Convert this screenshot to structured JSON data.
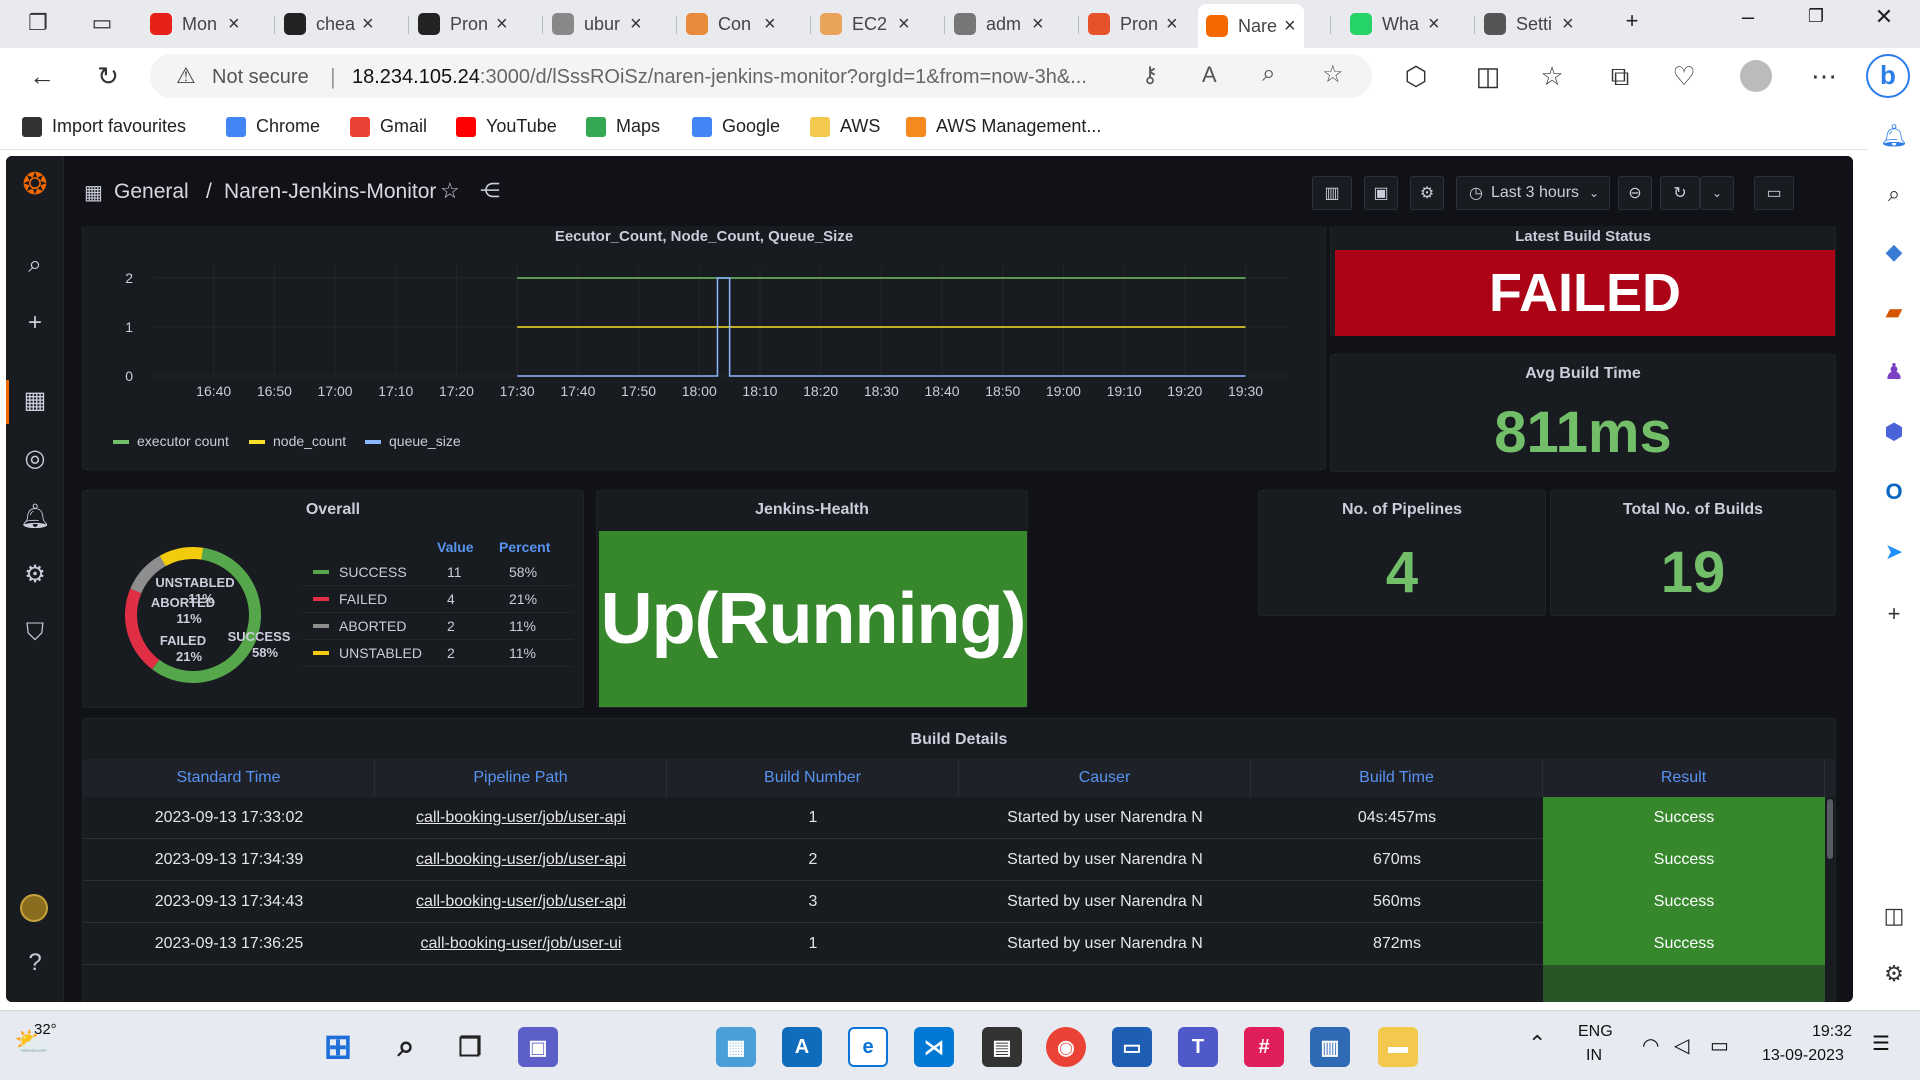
{
  "browser": {
    "tabs": [
      {
        "label": "Mon",
        "icon": "youtube-icon",
        "color": "#e62117"
      },
      {
        "label": "chea",
        "icon": "github-icon",
        "color": "#222222"
      },
      {
        "label": "Pron",
        "icon": "github-icon",
        "color": "#222222"
      },
      {
        "label": "ubur",
        "icon": "ubuntu-icon",
        "color": "#888888"
      },
      {
        "label": "Con",
        "icon": "console-icon",
        "color": "#e98a3a"
      },
      {
        "label": "EC2",
        "icon": "aws-cube-icon",
        "color": "#e9a35b"
      },
      {
        "label": "adm",
        "icon": "avatar-icon",
        "color": "#777777"
      },
      {
        "label": "Pron",
        "icon": "prometheus-icon",
        "color": "#e6522c"
      },
      {
        "label": "Nare",
        "icon": "grafana-icon",
        "color": "#f46800"
      },
      {
        "label": "Wha",
        "icon": "whatsapp-icon",
        "color": "#25d366"
      },
      {
        "label": "Setti",
        "icon": "gear-icon",
        "color": "#555555"
      }
    ],
    "security_label": "Not secure",
    "url_host": "18.234.105.24",
    "url_rest": ":3000/d/lSssROiSz/naren-jenkins-monitor?orgId=1&from=now-3h&...",
    "favourites": [
      {
        "label": "Import favourites",
        "icon": "import-icon",
        "color": "#333333"
      },
      {
        "label": "Chrome",
        "icon": "google-icon",
        "color": "#4285f4"
      },
      {
        "label": "Gmail",
        "icon": "gmail-icon",
        "color": "#ea4335"
      },
      {
        "label": "YouTube",
        "icon": "youtube-icon",
        "color": "#ff0000"
      },
      {
        "label": "Maps",
        "icon": "maps-icon",
        "color": "#34a853"
      },
      {
        "label": "Google",
        "icon": "google-icon",
        "color": "#4285f4"
      },
      {
        "label": "AWS",
        "icon": "folder-icon",
        "color": "#f2c94c"
      },
      {
        "label": "AWS Management...",
        "icon": "aws-cube-icon",
        "color": "#f48a1e"
      }
    ]
  },
  "grafana": {
    "breadcrumb_root": "General",
    "breadcrumb_sep": "/",
    "dashboard_title": "Naren-Jenkins-Monitor",
    "time_range": "Last 3 hours",
    "timeseries": {
      "title": "Eecutor_Count, Node_Count, Queue_Size"
    },
    "latest_build": {
      "title": "Latest Build Status",
      "value": "FAILED",
      "color": "#ad0317"
    },
    "avg_build": {
      "title": "Avg Build Time",
      "value": "811ms"
    },
    "overall": {
      "title": "Overall",
      "col_value": "Value",
      "col_percent": "Percent",
      "rows": [
        {
          "label": "SUCCESS",
          "value": "11",
          "percent": "58%",
          "color": "#56a64b"
        },
        {
          "label": "FAILED",
          "value": "4",
          "percent": "21%",
          "color": "#e02f44"
        },
        {
          "label": "ABORTED",
          "value": "2",
          "percent": "11%",
          "color": "#8e8e8e"
        },
        {
          "label": "UNSTABLED",
          "value": "2",
          "percent": "11%",
          "color": "#f2cc0c"
        }
      ],
      "slice_labels": [
        {
          "name": "UNSTABLED",
          "pct": "11%"
        },
        {
          "name": "ABORTED",
          "pct": "11%"
        },
        {
          "name": "FAILED",
          "pct": "21%"
        },
        {
          "name": "SUCCESS",
          "pct": "58%"
        }
      ]
    },
    "health": {
      "title": "Jenkins-Health",
      "value": "Up(Running)",
      "color": "#37872d"
    },
    "pipelines": {
      "title": "No. of Pipelines",
      "value": "4"
    },
    "total_builds": {
      "title": "Total No. of Builds",
      "value": "19"
    },
    "build_details": {
      "title": "Build Details",
      "columns": [
        "Standard Time",
        "Pipeline Path",
        "Build Number",
        "Causer",
        "Build Time",
        "Result"
      ],
      "rows": [
        {
          "time": "2023-09-13 17:33:02",
          "path": "call-booking-user/job/user-api",
          "num": "1",
          "causer": "Started by user Narendra N",
          "build_time": "04s:457ms",
          "result": "Success"
        },
        {
          "time": "2023-09-13 17:34:39",
          "path": "call-booking-user/job/user-api",
          "num": "2",
          "causer": "Started by user Narendra N",
          "build_time": "670ms",
          "result": "Success"
        },
        {
          "time": "2023-09-13 17:34:43",
          "path": "call-booking-user/job/user-api",
          "num": "3",
          "causer": "Started by user Narendra N",
          "build_time": "560ms",
          "result": "Success"
        },
        {
          "time": "2023-09-13 17:36:25",
          "path": "call-booking-user/job/user-ui",
          "num": "1",
          "causer": "Started by user Narendra N",
          "build_time": "872ms",
          "result": "Success"
        }
      ]
    }
  },
  "chart_data": {
    "type": "line",
    "title": "Eecutor_Count, Node_Count, Queue_Size",
    "x": [
      "16:40",
      "16:50",
      "17:00",
      "17:10",
      "17:20",
      "17:30",
      "17:40",
      "17:50",
      "18:00",
      "18:10",
      "18:20",
      "18:30",
      "18:40",
      "18:50",
      "19:00",
      "19:10",
      "19:20",
      "19:30"
    ],
    "ylim": [
      0,
      2
    ],
    "yticks": [
      "0",
      "1",
      "2"
    ],
    "series": [
      {
        "name": "executor count",
        "color": "#73bf69",
        "points": [
          [
            "17:30",
            2
          ],
          [
            "19:30",
            2
          ]
        ]
      },
      {
        "name": "node_count",
        "color": "#fade2a",
        "points": [
          [
            "17:30",
            1
          ],
          [
            "19:30",
            1
          ]
        ]
      },
      {
        "name": "queue_size",
        "color": "#8ab8ff",
        "points": [
          [
            "17:30",
            0
          ],
          [
            "18:03",
            0
          ],
          [
            "18:03",
            2
          ],
          [
            "18:05",
            2
          ],
          [
            "18:05",
            0
          ],
          [
            "19:30",
            0
          ]
        ]
      }
    ],
    "legend": "bottom-left",
    "grid": true
  },
  "taskbar": {
    "temperature": "32°",
    "lang1": "ENG",
    "lang2": "IN",
    "time": "19:32",
    "date": "13-09-2023"
  }
}
